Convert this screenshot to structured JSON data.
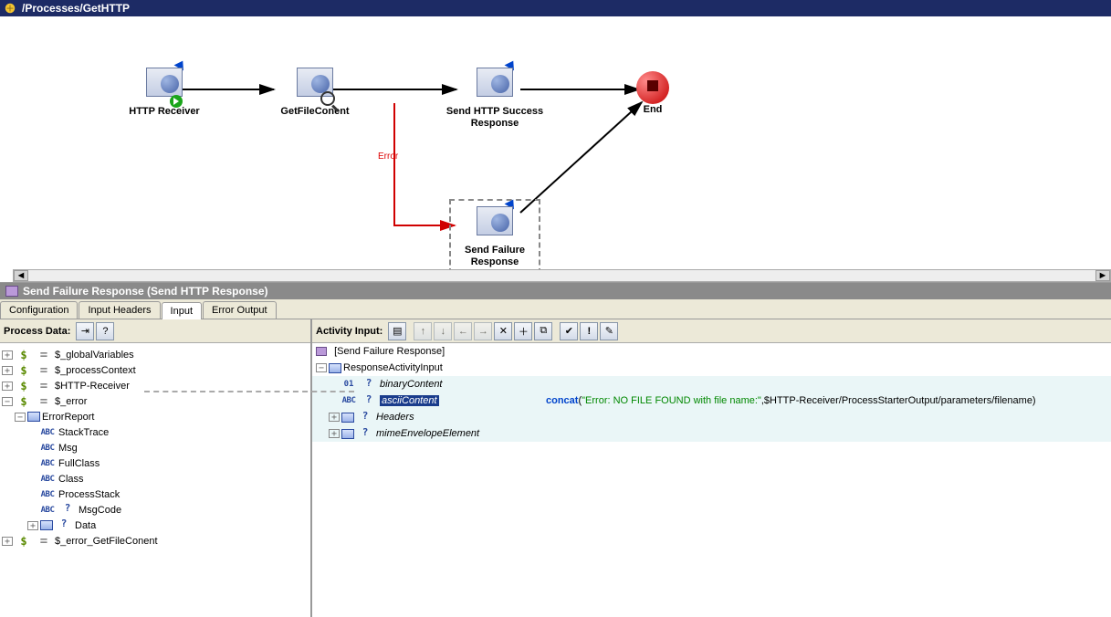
{
  "breadcrumb": {
    "path": "/Processes/GetHTTP"
  },
  "canvas": {
    "nodes": {
      "receiver": "HTTP Receiver",
      "getfile": "GetFileConent",
      "success": "Send HTTP Success Response",
      "failure": "Send Failure Response",
      "end": "End"
    },
    "error_label": "Error"
  },
  "panel": {
    "title": "Send Failure Response (Send HTTP Response)"
  },
  "tabs": {
    "items": [
      "Configuration",
      "Input Headers",
      "Input",
      "Error Output"
    ],
    "active_index": 2
  },
  "process_data": {
    "title": "Process Data:",
    "items": [
      "$_globalVariables",
      "$_processContext",
      "$HTTP-Receiver",
      "$_error",
      "ErrorReport",
      "StackTrace",
      "Msg",
      "FullClass",
      "Class",
      "ProcessStack",
      "MsgCode",
      "Data",
      "$_error_GetFileConent"
    ]
  },
  "activity_input": {
    "title": "Activity Input:",
    "root": "[Send Failure Response]",
    "group": "ResponseActivityInput",
    "rows": {
      "binary": "binaryContent",
      "ascii": "asciiContent",
      "headers": "Headers",
      "mime": "mimeEnvelopeElement"
    },
    "expr": {
      "func": "concat",
      "open": "(",
      "str": "\"Error: NO FILE FOUND with file name:\"",
      "rest": ",$HTTP-Receiver/ProcessStarterOutput/parameters/filename)"
    }
  }
}
